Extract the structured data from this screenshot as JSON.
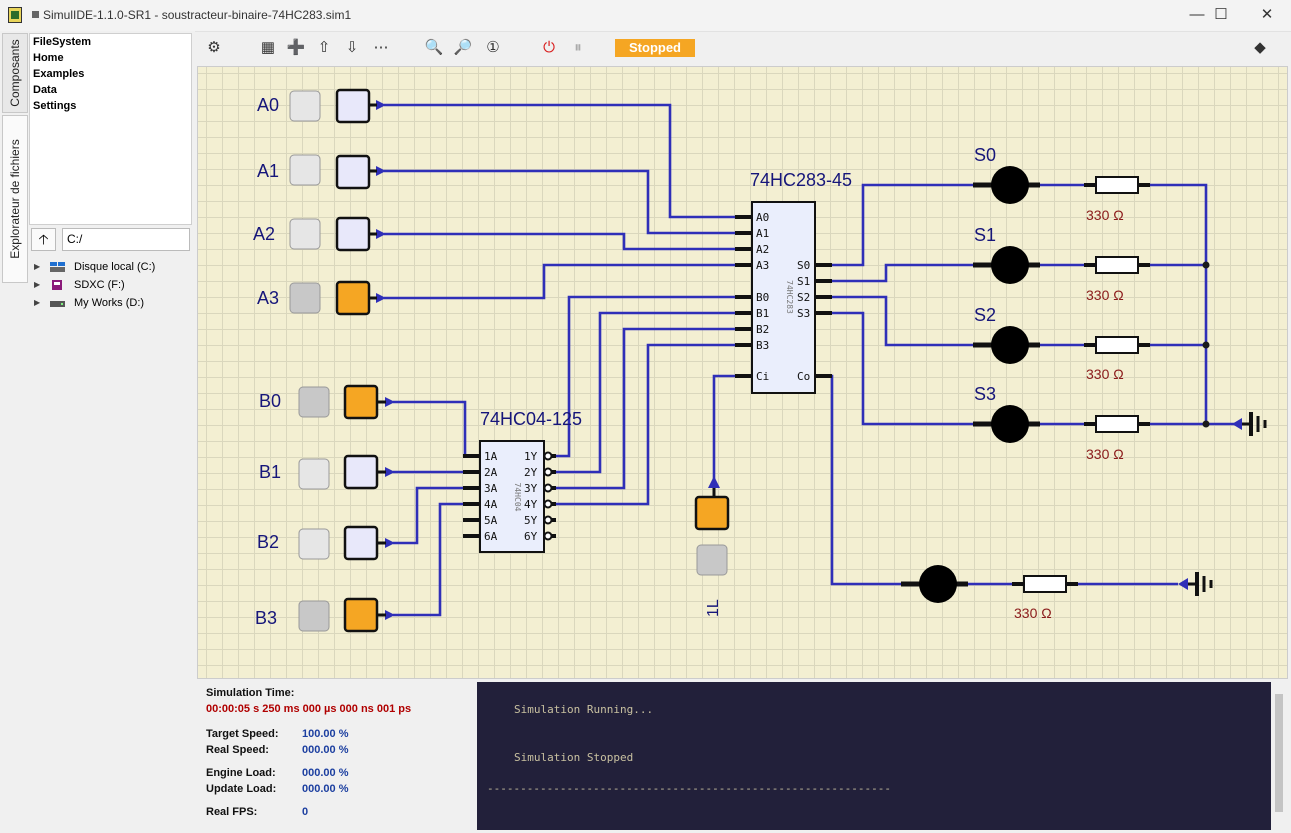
{
  "window": {
    "title": "SimulIDE-1.1.0-SR1 - soustracteur-binaire-74HC283.sim1"
  },
  "side_tabs": {
    "components": "Composants",
    "file_explorer": "Explorateur de fichiers"
  },
  "filesystem": {
    "items": [
      "FileSystem",
      "Home",
      "Examples",
      "Data",
      "Settings"
    ]
  },
  "path": "C:/",
  "drives": [
    {
      "label": "Disque local (C:)",
      "icon": "windows-drive-icon"
    },
    {
      "label": "SDXC (F:)",
      "icon": "sd-card-icon"
    },
    {
      "label": "My Works (D:)",
      "icon": "drive-icon"
    }
  ],
  "toolbar": {
    "status": "Stopped",
    "status_color": "#f5a623"
  },
  "circuit": {
    "adder_label": "74HC283-45",
    "adder_body_label": "74HC283",
    "adder_pins_left": [
      "A0",
      "A1",
      "A2",
      "A3",
      "B0",
      "B1",
      "B2",
      "B3",
      "Ci"
    ],
    "adder_pins_right": [
      "S0",
      "S1",
      "S2",
      "S3",
      "Co"
    ],
    "inverter_label": "74HC04-125",
    "inverter_body_label": "74HC04",
    "inverter_pins_left": [
      "1A",
      "2A",
      "3A",
      "4A",
      "5A",
      "6A"
    ],
    "inverter_pins_right": [
      "1Y",
      "2Y",
      "3Y",
      "4Y",
      "5Y",
      "6Y"
    ],
    "inputs_a": [
      "A0",
      "A1",
      "A2",
      "A3"
    ],
    "inputs_a_state": [
      false,
      false,
      false,
      true
    ],
    "inputs_b": [
      "B0",
      "B1",
      "B2",
      "B3"
    ],
    "inputs_b_state": [
      true,
      false,
      false,
      true
    ],
    "carry_label": "1L",
    "outputs": [
      "S0",
      "S1",
      "S2",
      "S3"
    ],
    "resistor_value": "330 Ω",
    "on_color": "#f5a623",
    "off_color": "#e8e8fa",
    "wire_color": "#2f2fb8"
  },
  "stats": {
    "sim_time_label": "Simulation Time:",
    "sim_time_value": "00:00:05 s  250 ms  000 µs  000 ns  001 ps",
    "target_speed_label": "Target Speed:",
    "target_speed_value": "100.00 %",
    "real_speed_label": "Real Speed:",
    "real_speed_value": "000.00 %",
    "engine_load_label": "Engine Load:",
    "engine_load_value": "000.00 %",
    "update_load_label": "Update Load:",
    "update_load_value": "000.00 %",
    "real_fps_label": "Real FPS:",
    "real_fps_value": "0"
  },
  "console": {
    "line1": "Simulation Running...",
    "line2": "Simulation Stopped",
    "line3": "-------------------------------------------------------------"
  }
}
